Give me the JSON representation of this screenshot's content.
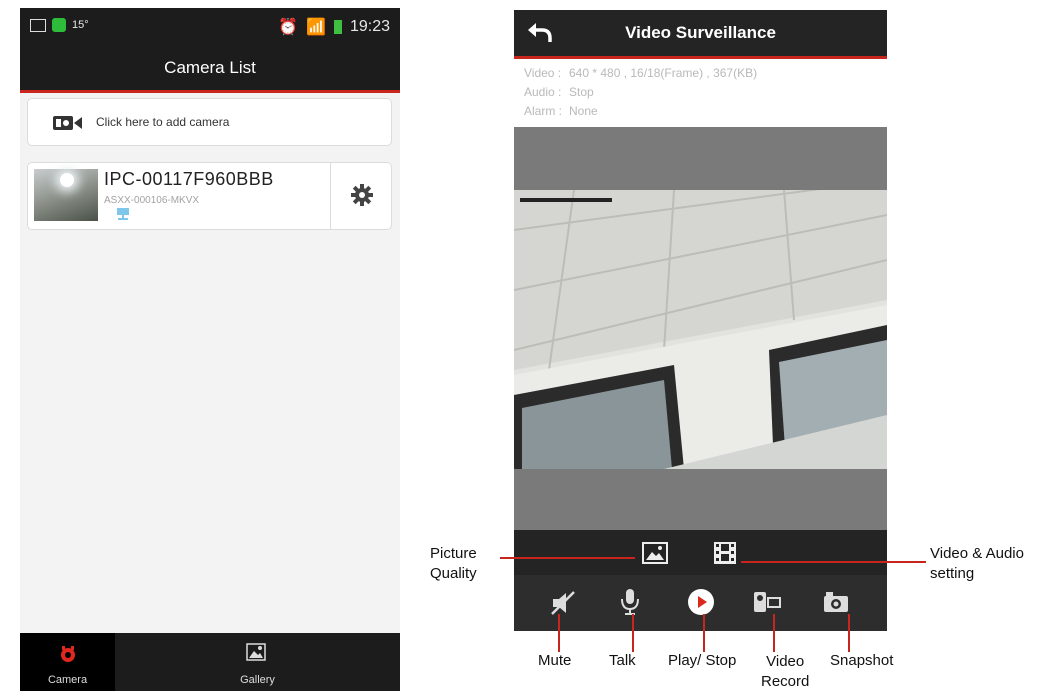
{
  "left_screen": {
    "status": {
      "temp": "15°",
      "time": "19:23"
    },
    "title": "Camera List",
    "add_camera_label": "Click here to add camera",
    "camera": {
      "name": "IPC-00117F960BBB",
      "id": "ASXX-000106-MKVX"
    },
    "nav": {
      "camera": "Camera",
      "gallery": "Gallery"
    }
  },
  "right_screen": {
    "title": "Video Surveillance",
    "info": {
      "video_key": "Video :",
      "video_val": "640 * 480  , 16/18(Frame) , 367(KB)",
      "audio_key": "Audio :",
      "audio_val": "Stop",
      "alarm_key": "Alarm :",
      "alarm_val": "None"
    }
  },
  "annotations": {
    "picture_quality": "Picture\nQuality",
    "video_audio_setting": "Video & Audio\nsetting",
    "mute": "Mute",
    "talk": "Talk",
    "play_stop": "Play/ Stop",
    "video_record": "Video\nRecord",
    "snapshot": "Snapshot"
  },
  "colors": {
    "accent": "#c8261d",
    "bar": "#242424"
  }
}
